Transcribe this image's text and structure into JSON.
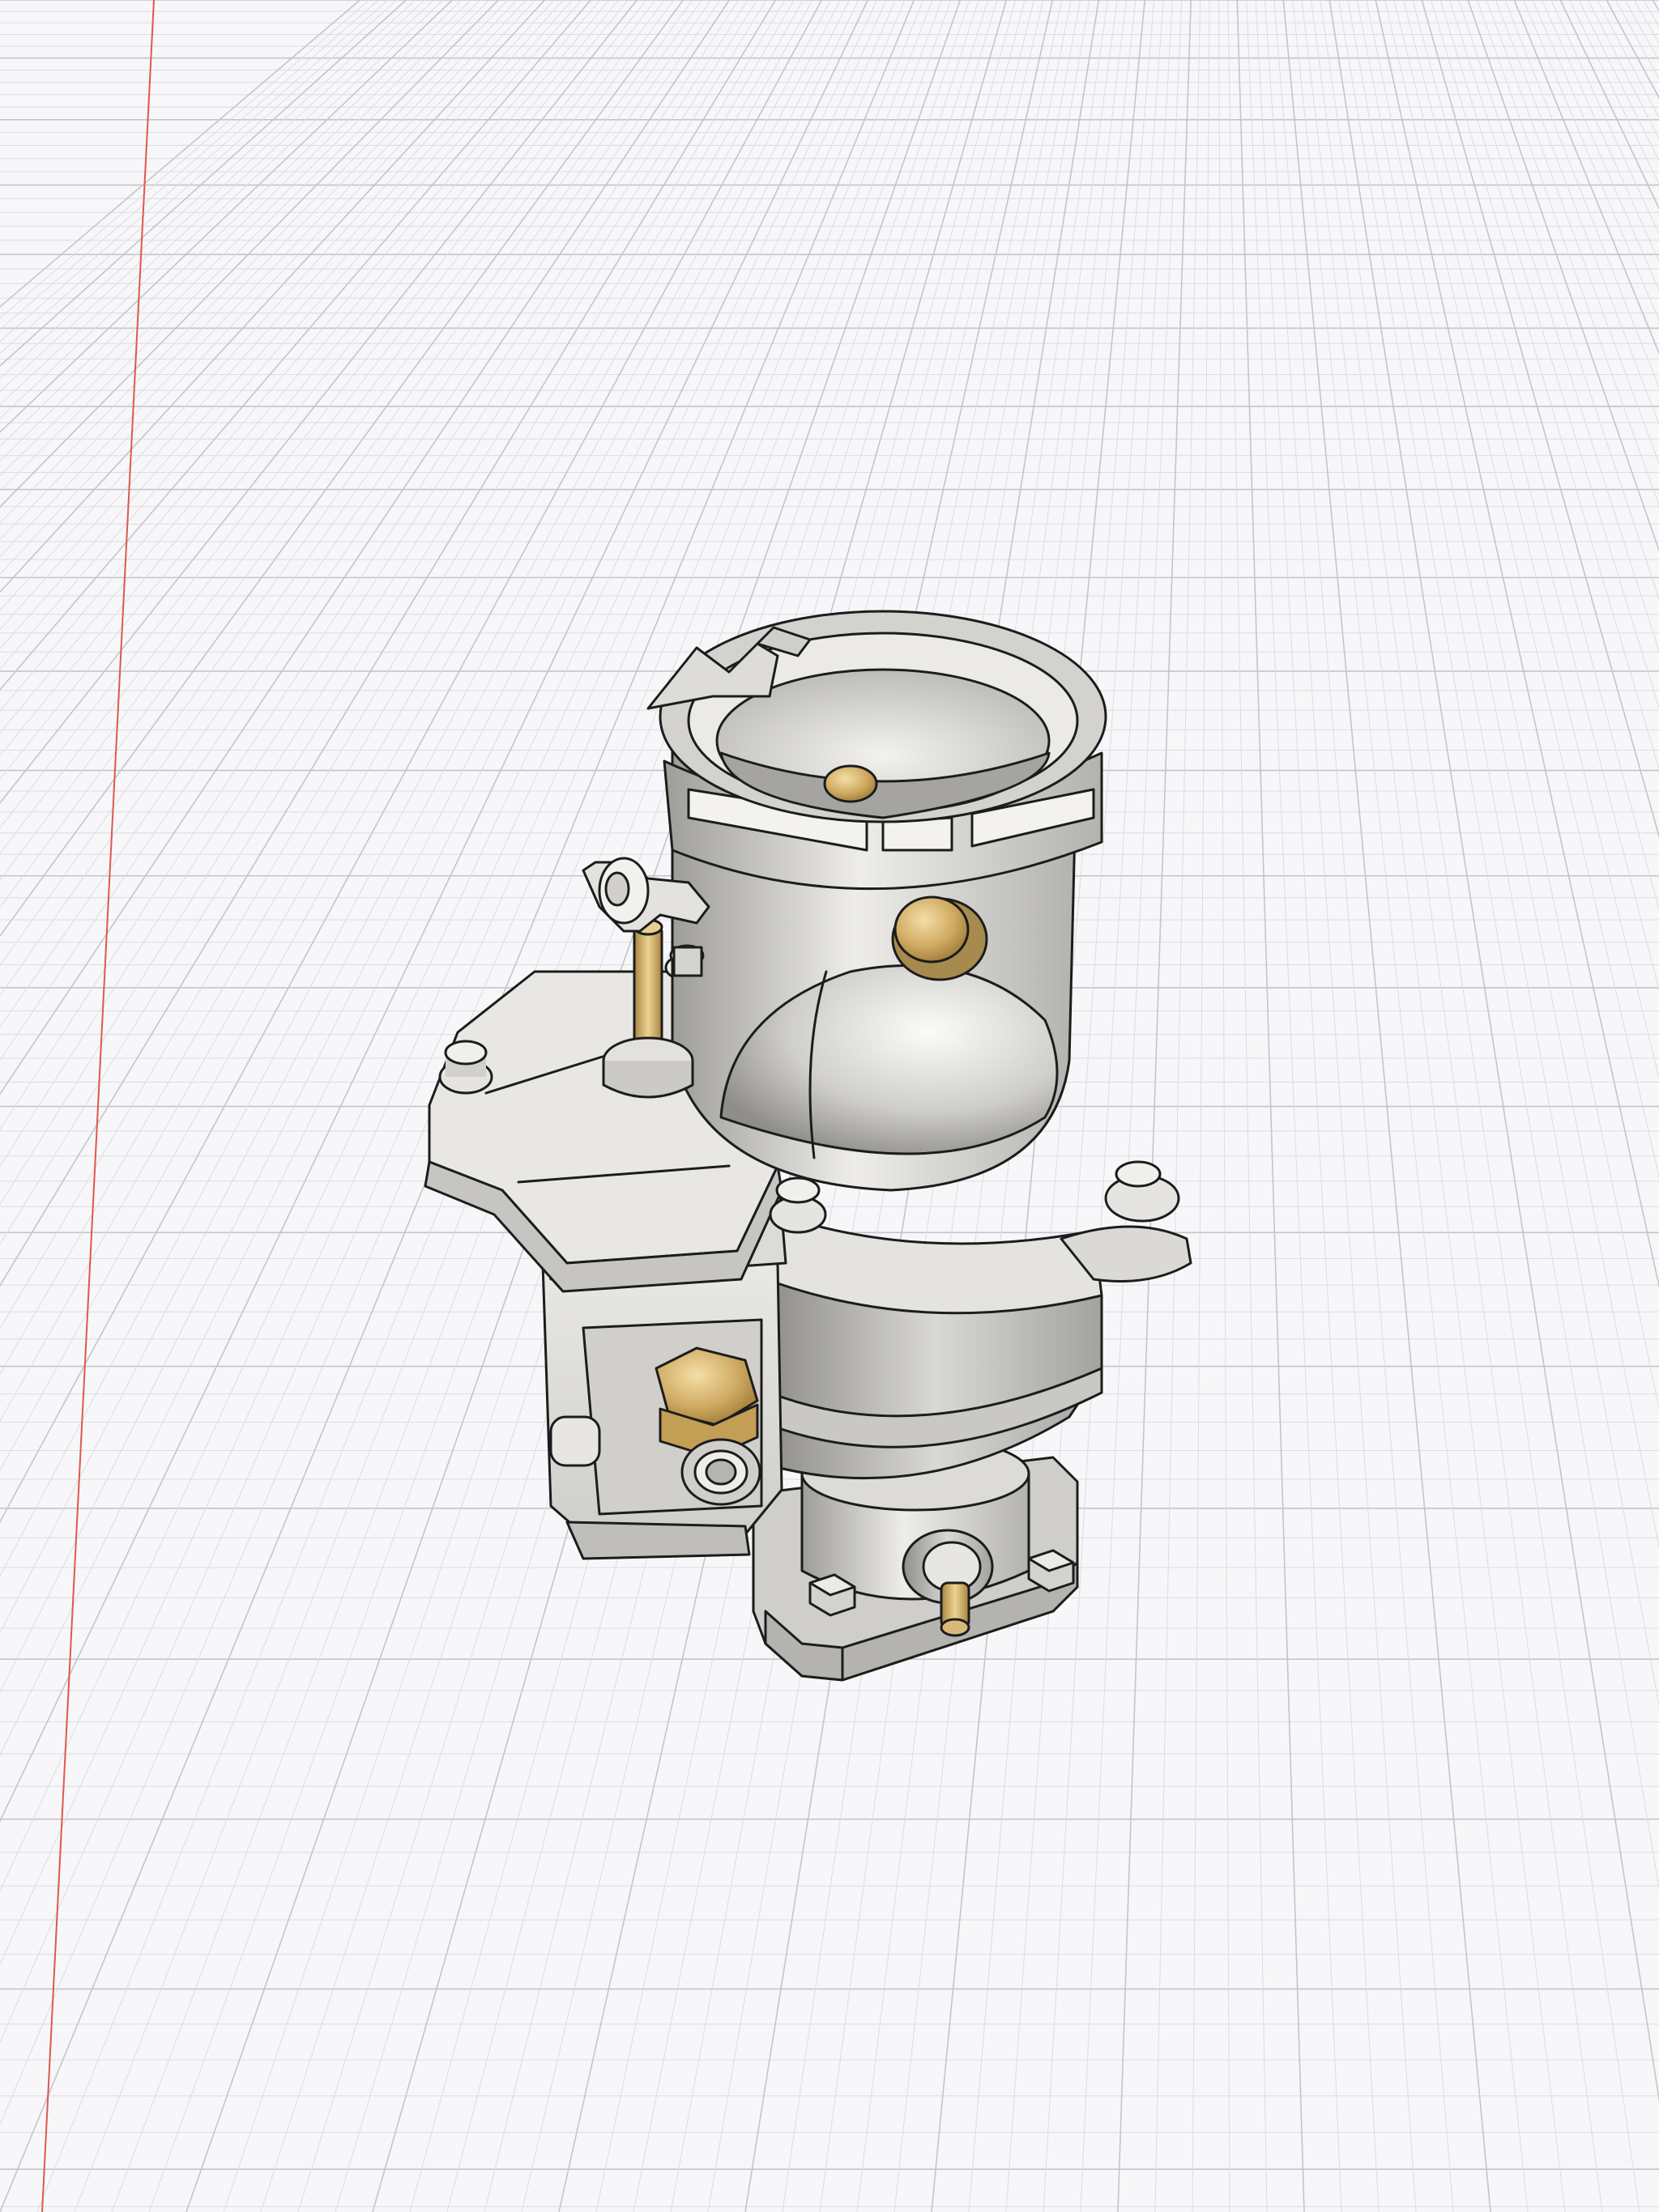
{
  "app": {
    "view": "3d-cad-viewport",
    "background_color": "#f7f7f9"
  },
  "scene": {
    "grid": {
      "visible": true,
      "minor_color": "#dcdce2",
      "major_color": "#c4c4cc"
    },
    "axis_line_color": "#e0574f",
    "model": {
      "body_color": "#d8d7d3",
      "highlight_color": "#f2f1ee",
      "shadow_color": "#a9a8a4",
      "outline_color": "#1c1c1c",
      "brass_color": "#cfa961"
    }
  }
}
